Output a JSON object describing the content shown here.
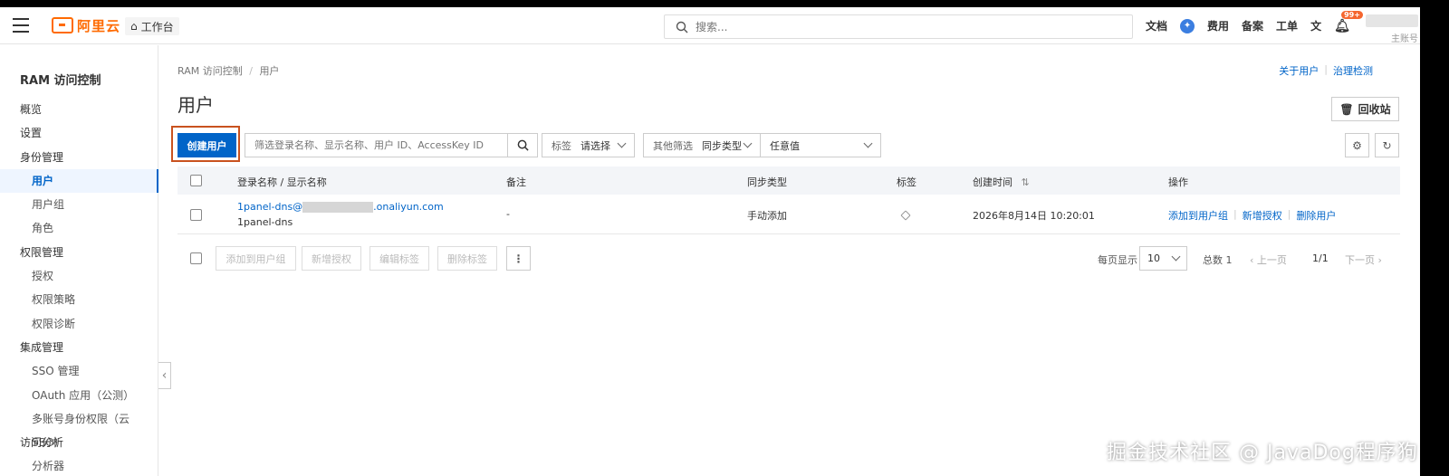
{
  "header": {
    "logo_text": "阿里云",
    "workbench": "工作台",
    "search_placeholder": "搜索...",
    "links": [
      "文档",
      "费用",
      "备案",
      "工单"
    ],
    "notification_badge": "99+",
    "account_type": "主账号"
  },
  "sidebar": {
    "title": "RAM 访问控制",
    "items": [
      {
        "label": "概览",
        "level": 0
      },
      {
        "label": "设置",
        "level": 0
      },
      {
        "label": "身份管理",
        "level": 0
      },
      {
        "label": "用户",
        "level": 1,
        "active": true
      },
      {
        "label": "用户组",
        "level": 1
      },
      {
        "label": "角色",
        "level": 1
      },
      {
        "label": "权限管理",
        "level": 0
      },
      {
        "label": "授权",
        "level": 1
      },
      {
        "label": "权限策略",
        "level": 1
      },
      {
        "label": "权限诊断",
        "level": 1
      },
      {
        "label": "集成管理",
        "level": 0
      },
      {
        "label": "SSO 管理",
        "level": 1
      },
      {
        "label": "OAuth 应用（公测）",
        "level": 1
      },
      {
        "label": "多账号身份权限（云 SSO）",
        "level": 1
      },
      {
        "label": "访问分析",
        "level": 0
      },
      {
        "label": "分析器",
        "level": 1
      }
    ]
  },
  "main": {
    "breadcrumb": [
      "RAM 访问控制",
      "用户"
    ],
    "top_links": [
      "关于用户",
      "治理检测"
    ],
    "title": "用户",
    "recycle_btn": "回收站",
    "create_btn": "创建用户",
    "filter_placeholder": "筛选登录名称、显示名称、用户 ID、AccessKey ID",
    "tag_select": {
      "label": "标签",
      "value": "请选择"
    },
    "other_filter": {
      "label": "其他筛选",
      "value": "同步类型"
    },
    "any_value": "任意值"
  },
  "table": {
    "columns": [
      "登录名称 / 显示名称",
      "备注",
      "同步类型",
      "标签",
      "创建时间",
      "操作"
    ],
    "sort_indicator": "⇅",
    "rows": [
      {
        "login_prefix": "1panel-dns@",
        "login_suffix": ".onaliyun.com",
        "display_name": "1panel-dns",
        "note": "-",
        "sync_type": "手动添加",
        "created": "2026年8月14日 10:20:01",
        "actions": [
          "添加到用户组",
          "新增授权",
          "删除用户"
        ]
      }
    ]
  },
  "footer": {
    "batch_buttons": [
      "添加到用户组",
      "新增授权",
      "编辑标签",
      "删除标签"
    ],
    "more": "⋮",
    "per_page_label": "每页显示",
    "per_page_value": "10",
    "total_label": "总数 1",
    "prev": "上一页",
    "page": "1/1",
    "next": "下一页"
  },
  "watermark": "掘金技术社区 @ JavaDog程序狗"
}
